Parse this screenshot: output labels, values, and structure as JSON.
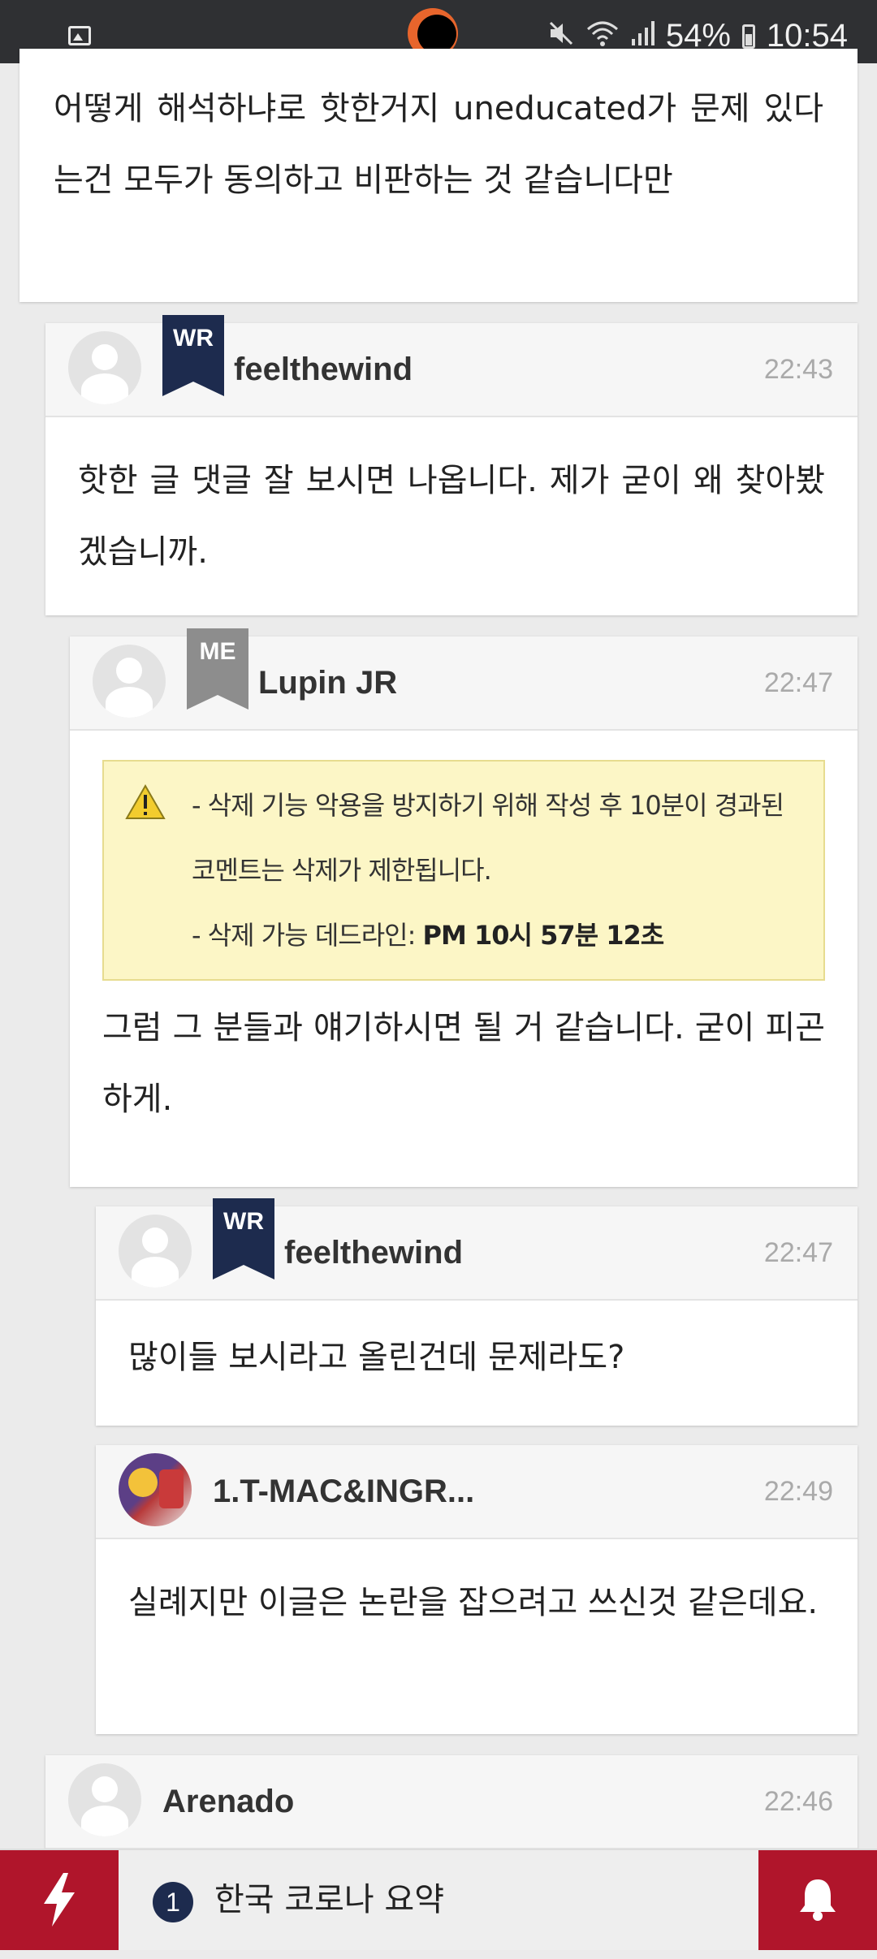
{
  "status_bar": {
    "battery": "54%",
    "time": "10:54",
    "icons": [
      "gallery-icon",
      "mute-icon",
      "wifi-icon",
      "signal-icon",
      "battery-icon"
    ]
  },
  "top_comment": {
    "text": "어떻게 해석하냐로 핫한거지 uneducated가 문제 있다는건 모두가 동의하고 비판하는 것 같습니다만"
  },
  "comments": [
    {
      "badge": "WR",
      "username": "feelthewind",
      "time": "22:43",
      "text": "핫한 글 댓글 잘 보시면 나옵니다. 제가 굳이 왜 찾아봤겠습니까."
    },
    {
      "badge": "ME",
      "username": "Lupin JR",
      "time": "22:47",
      "notice_line1": "- 삭제 기능 악용을 방지하기 위해 작성 후 10분이 경과된 코멘트는 삭제가 제한됩니다.",
      "notice_line2_label": "- 삭제 가능 데드라인: ",
      "notice_line2_value": "PM 10시 57분 12초",
      "text": "그럼 그 분들과 얘기하시면 될 거 같습니다. 굳이 피곤하게."
    },
    {
      "badge": "WR",
      "username": "feelthewind",
      "time": "22:47",
      "text": "많이들 보시라고 올린건데 문제라도?"
    },
    {
      "username": "1.T-MAC&INGR...",
      "time": "22:49",
      "text": "실례지만 이글은 논란을 잡으려고 쓰신것 같은데요."
    },
    {
      "username": "Arenado",
      "time": "22:46"
    }
  ],
  "bottom_bar": {
    "rank": "1",
    "headline": "한국 코로나 요약"
  },
  "colors": {
    "badge_wr": "#1d2b4e",
    "badge_me": "#8d8d8d",
    "bar_red": "#b0152b",
    "notice_bg": "#fcf6c6"
  }
}
